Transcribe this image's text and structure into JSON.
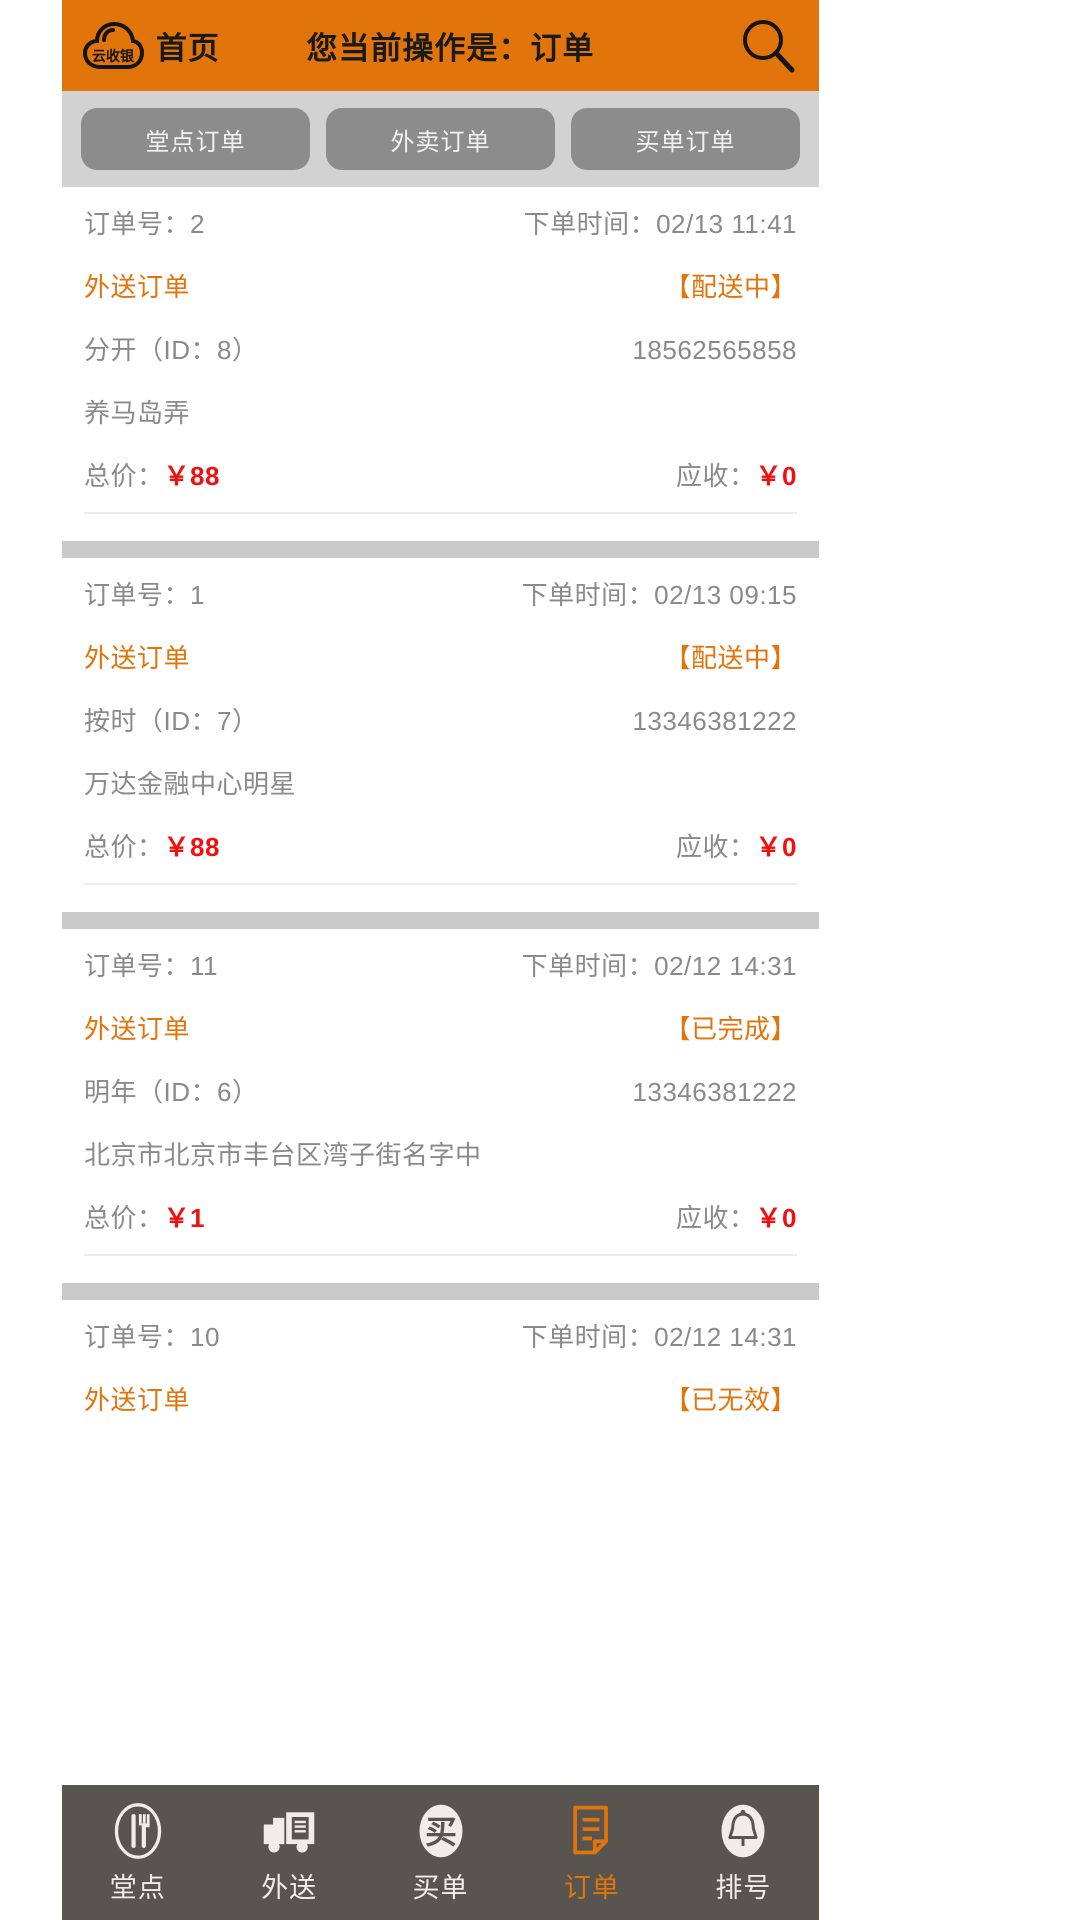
{
  "header": {
    "logo_text": "云收银",
    "home_label": "首页",
    "title": "您当前操作是：订单",
    "search_icon": "search-icon",
    "bg_color": "#E2740C"
  },
  "tabs": [
    {
      "label": "堂点订单",
      "active": false
    },
    {
      "label": "外卖订单",
      "active": false
    },
    {
      "label": "买单订单",
      "active": false
    }
  ],
  "labels": {
    "order_no": "订单号：",
    "order_time": "下单时间：",
    "total_price": "总价：",
    "receivable": "应收："
  },
  "colors": {
    "accent": "#E2740C",
    "money": "#F01010",
    "text": "#8A8A8A",
    "tab_bg": "#8C8C8C",
    "nav_bg": "#585450"
  },
  "orders": [
    {
      "order_no": "2",
      "order_time": "02/13 11:41",
      "type": "外送订单",
      "status": "【配送中】",
      "customer": "分开（ID：8）",
      "phone": "18562565858",
      "address": "养马岛弄",
      "total": "￥88",
      "receivable": "￥0"
    },
    {
      "order_no": "1",
      "order_time": "02/13 09:15",
      "type": "外送订单",
      "status": "【配送中】",
      "customer": "按时（ID：7）",
      "phone": "13346381222",
      "address": "万达金融中心明星",
      "total": "￥88",
      "receivable": "￥0"
    },
    {
      "order_no": "11",
      "order_time": "02/12 14:31",
      "type": "外送订单",
      "status": "【已完成】",
      "customer": "明年（ID：6）",
      "phone": "13346381222",
      "address": "北京市北京市丰台区湾子街名字中",
      "total": "￥1",
      "receivable": "￥0"
    },
    {
      "order_no": "10",
      "order_time": "02/12 14:31",
      "type": "外送订单",
      "status": "【已无效】",
      "customer": "",
      "phone": "",
      "address": "",
      "total": "",
      "receivable": ""
    }
  ],
  "bottom_nav": [
    {
      "label": "堂点",
      "icon": "cutlery-icon",
      "active": false
    },
    {
      "label": "外送",
      "icon": "truck-icon",
      "active": false
    },
    {
      "label": "买单",
      "icon": "buy-circle-icon",
      "active": false
    },
    {
      "label": "订单",
      "icon": "document-icon",
      "active": true
    },
    {
      "label": "排号",
      "icon": "bell-icon",
      "active": false
    }
  ]
}
